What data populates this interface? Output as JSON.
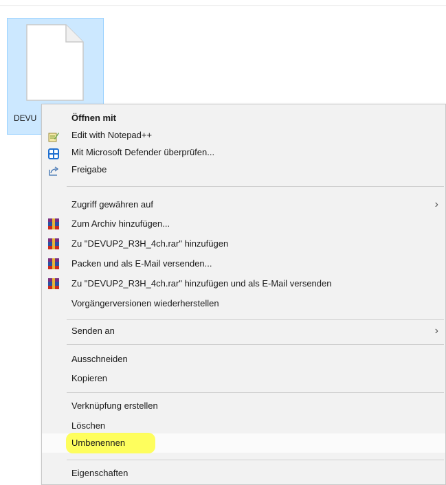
{
  "file": {
    "name": "DEVU"
  },
  "menu": {
    "open_with": "Öffnen mit",
    "edit_notepad": "Edit with Notepad++",
    "defender": "Mit Microsoft Defender überprüfen...",
    "share": "Freigabe",
    "give_access": "Zugriff gewähren auf",
    "add_archive": "Zum Archiv hinzufügen...",
    "add_rar": "Zu \"DEVUP2_R3H_4ch.rar\" hinzufügen",
    "pack_email": "Packen und als E-Mail versenden...",
    "add_rar_email": "Zu \"DEVUP2_R3H_4ch.rar\" hinzufügen und als E-Mail versenden",
    "restore_versions": "Vorgängerversionen wiederherstellen",
    "send_to": "Senden an",
    "cut": "Ausschneiden",
    "copy": "Kopieren",
    "create_shortcut": "Verknüpfung erstellen",
    "delete": "Löschen",
    "rename": "Umbenennen",
    "properties": "Eigenschaften"
  },
  "icons": {
    "notepad": "notepad-plus-plus-icon",
    "defender": "defender-shield-icon",
    "share": "share-icon",
    "winrar": "winrar-icon",
    "submenu": "chevron-right-icon"
  },
  "colors": {
    "selection_fill": "#cce8ff",
    "menu_background": "#f2f2f2",
    "highlighter": "#ffff28"
  }
}
